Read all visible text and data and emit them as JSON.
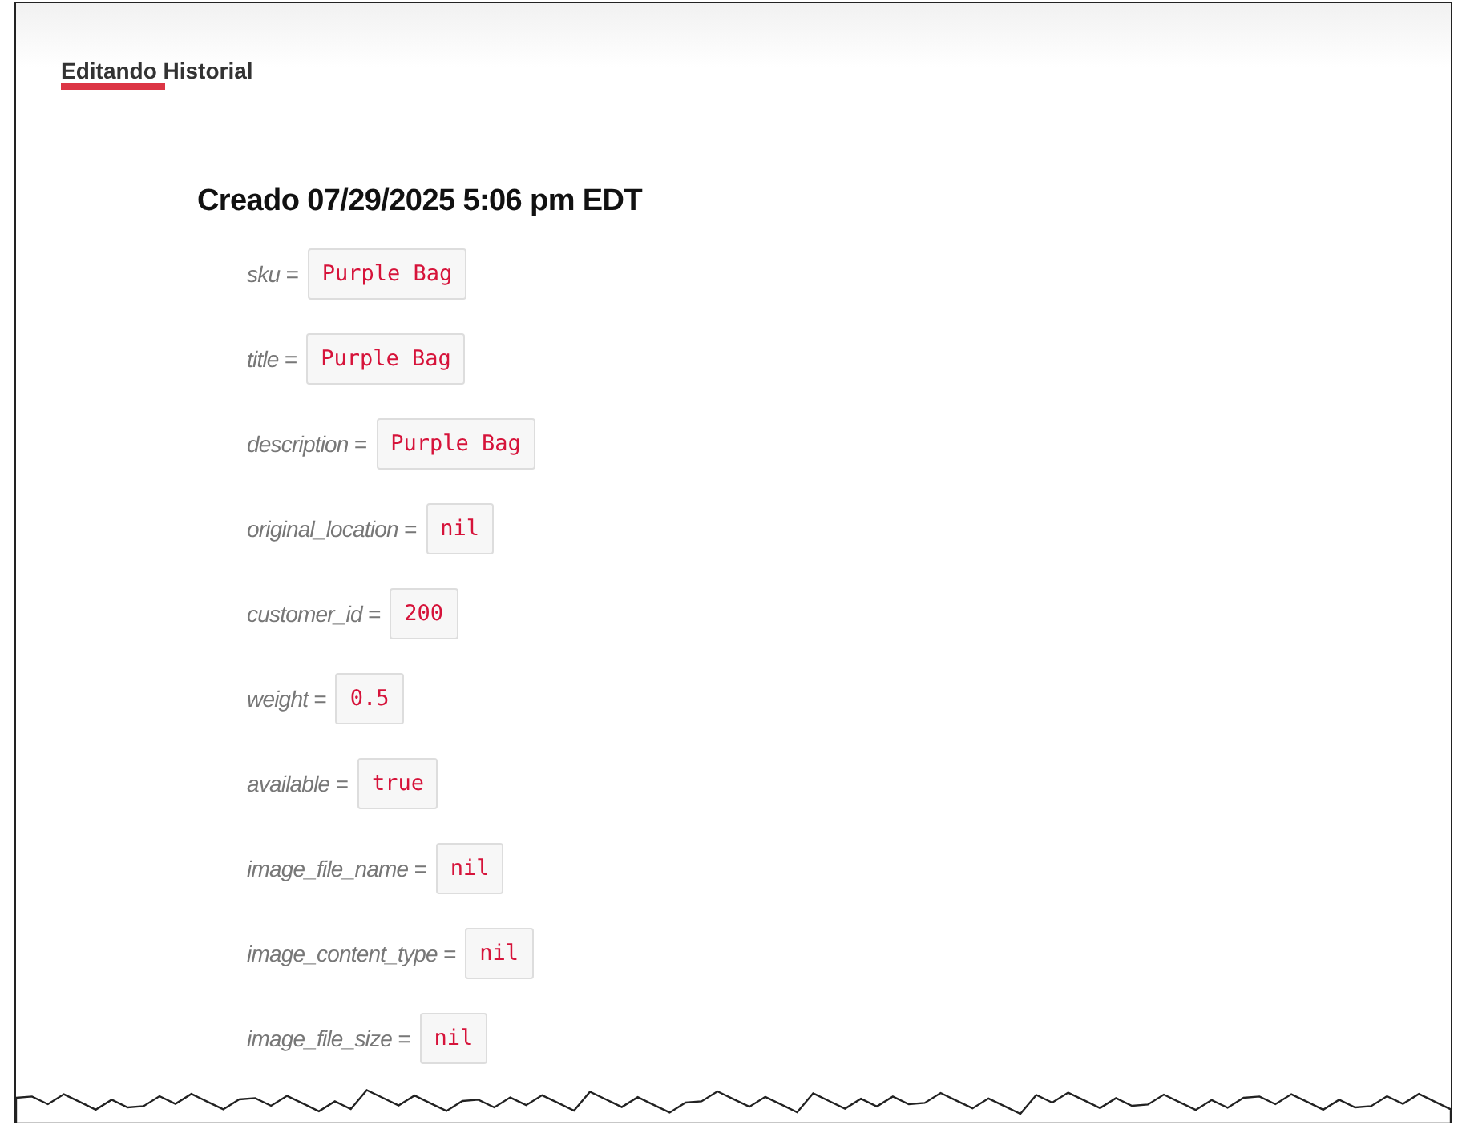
{
  "tabs": [
    {
      "label": "Editando Historial",
      "selected": true
    }
  ],
  "version": {
    "title": "Creado 07/29/2025 5:06 pm EDT",
    "fields": [
      {
        "label": "sku =",
        "value": "Purple Bag"
      },
      {
        "label": "title =",
        "value": "Purple Bag"
      },
      {
        "label": "description =",
        "value": "Purple Bag"
      },
      {
        "label": "original_location =",
        "value": "nil"
      },
      {
        "label": "customer_id =",
        "value": "200"
      },
      {
        "label": "weight =",
        "value": "0.5"
      },
      {
        "label": "available =",
        "value": "true"
      },
      {
        "label": "image_file_name =",
        "value": "nil"
      },
      {
        "label": "image_content_type =",
        "value": "nil"
      },
      {
        "label": "image_file_size =",
        "value": "nil"
      }
    ]
  }
}
